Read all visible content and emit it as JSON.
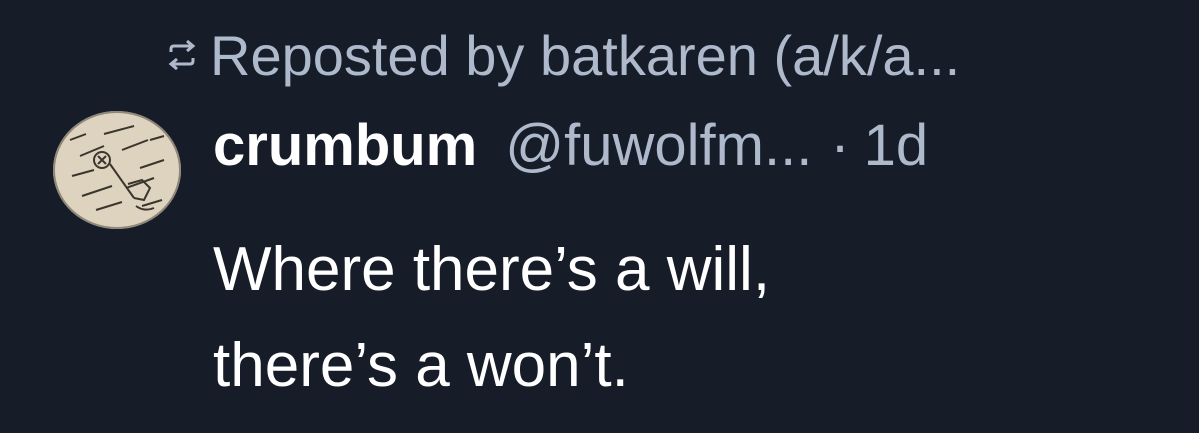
{
  "repost": {
    "icon": "repost-icon",
    "label": "Reposted by batkaren (a/k/a..."
  },
  "post": {
    "avatar_icon": "illustrated-avatar",
    "author_name": "crumbum",
    "author_handle": "@fuwolfm...",
    "separator": "·",
    "time": "1d",
    "text_lines": [
      "Where there’s a will,",
      "there’s a won’t."
    ]
  },
  "colors": {
    "background": "#161c28",
    "primary_text": "#ffffff",
    "secondary_text": "#aebacb"
  }
}
